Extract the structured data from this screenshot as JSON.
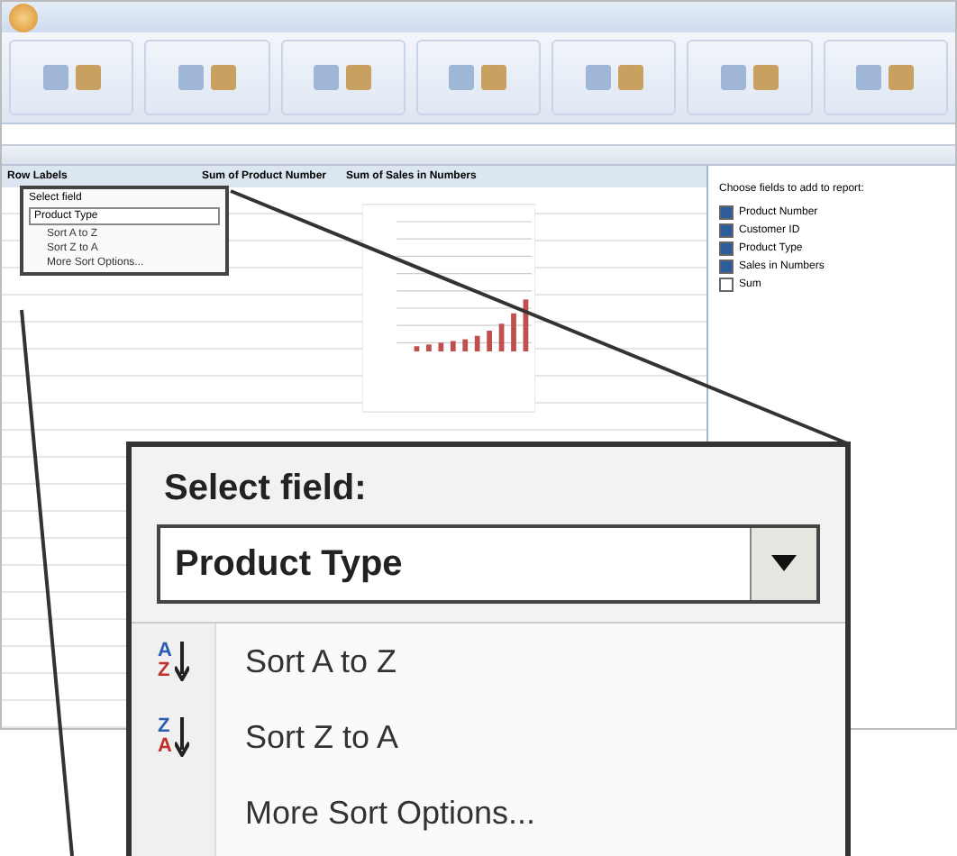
{
  "pivot_headers": [
    "Row Labels",
    "Sum of Product Number",
    "Sum of Sales in Numbers"
  ],
  "mini_menu": {
    "title": "Select field",
    "field": "Product Type",
    "items": [
      "Sort A to Z",
      "Sort Z to A",
      "More Sort Options..."
    ]
  },
  "field_list": {
    "prompt": "Choose fields to add to report:",
    "fields": [
      {
        "label": "Product Number",
        "checked": true
      },
      {
        "label": "Customer ID",
        "checked": true
      },
      {
        "label": "Product Type",
        "checked": true
      },
      {
        "label": "Sales in Numbers",
        "checked": true
      },
      {
        "label": "Sum",
        "checked": false
      }
    ]
  },
  "callout": {
    "title": "Select field:",
    "field": "Product Type",
    "items": [
      {
        "label": "Sort A to Z",
        "kind": "sort-asc",
        "icon_top": "A",
        "icon_bottom": "Z"
      },
      {
        "label": "Sort Z to A",
        "kind": "sort-desc",
        "icon_top": "Z",
        "icon_bottom": "A"
      },
      {
        "label": "More Sort Options...",
        "kind": "more"
      }
    ]
  }
}
